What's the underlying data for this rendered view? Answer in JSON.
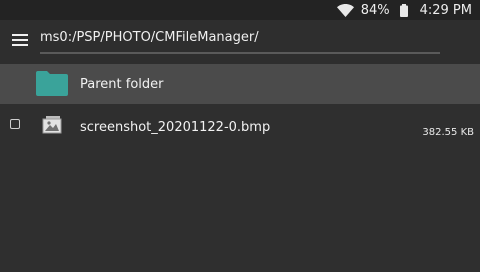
{
  "status_bar": {
    "battery_percent": "84%",
    "time": "4:29 PM",
    "icons": [
      "wifi-icon",
      "battery-icon"
    ]
  },
  "header": {
    "menu_icon": "menu-icon",
    "path": "ms0:/PSP/PHOTO/CMFileManager/"
  },
  "files": {
    "parent": {
      "label": "Parent folder",
      "icon": "folder-icon",
      "icon_color": "#3aa39a"
    },
    "items": [
      {
        "name": "screenshot_20201122-0.bmp",
        "size": "382.55 KB",
        "icon": "image-icon"
      }
    ]
  },
  "colors": {
    "background": "#2f2f2f",
    "status_bar": "#232323",
    "selected_row": "#4b4b4b",
    "folder": "#3aa39a"
  }
}
